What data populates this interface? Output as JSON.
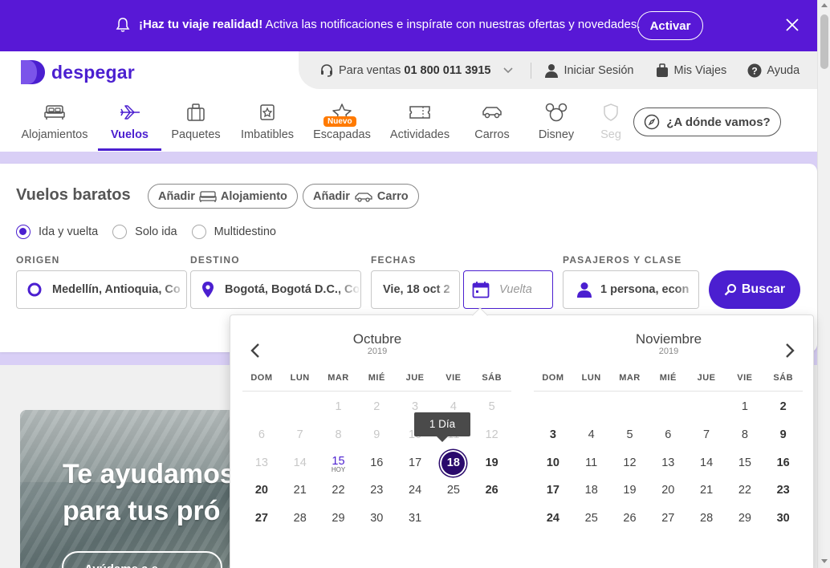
{
  "banner": {
    "bold_text": "¡Haz tu viaje realidad!",
    "text": " Activa las notificaciones e inspírate con nuestras ofertas y novedades.",
    "activate_label": "Activar",
    "bg_color": "#5818d6"
  },
  "brand": {
    "name": "despegar",
    "color": "#4b1fd0"
  },
  "topbar": {
    "sales_label": "Para ventas",
    "sales_phone": "01 800 011 3915",
    "login_label": "Iniciar Sesión",
    "trips_label": "Mis Viajes",
    "help_label": "Ayuda"
  },
  "nav": {
    "tabs": [
      {
        "label": "Alojamientos",
        "icon": "bed-icon"
      },
      {
        "label": "Vuelos",
        "icon": "plane-icon",
        "active": true
      },
      {
        "label": "Paquetes",
        "icon": "suitcase-icon"
      },
      {
        "label": "Imbatibles",
        "icon": "medal-icon"
      },
      {
        "label": "Escapadas",
        "icon": "star-icon",
        "badge": "Nuevo"
      },
      {
        "label": "Actividades",
        "icon": "ticket-icon"
      },
      {
        "label": "Carros",
        "icon": "car-icon"
      },
      {
        "label": "Disney",
        "icon": "mickey-icon"
      },
      {
        "label": "Seg",
        "icon": "shield-icon"
      }
    ],
    "where_label": "¿A dónde vamos?"
  },
  "search": {
    "title": "Vuelos baratos",
    "add_hotel_prefix": "Añadir",
    "add_hotel_label": "Alojamiento",
    "add_car_prefix": "Añadir",
    "add_car_label": "Carro",
    "trip_types": [
      "Ida y vuelta",
      "Solo ida",
      "Multidestino"
    ],
    "trip_type_selected": "Ida y vuelta",
    "origin_label": "ORIGEN",
    "origin_value": "Medellín, Antioquia, Co",
    "destination_label": "DESTINO",
    "destination_value": "Bogotá, Bogotá D.C., Co",
    "dates_label": "FECHAS",
    "depart_value": "Vie, 18 oct 2",
    "return_placeholder": "Vuelta",
    "passengers_label": "PASAJEROS Y CLASE",
    "passengers_value": "1 persona, econ",
    "search_label": "Buscar"
  },
  "promo": {
    "line1": "Te ayudamos",
    "line2": "para tus pró",
    "button": "Ayúdame a e"
  },
  "calendar": {
    "tooltip": "1 Día",
    "weekdays": [
      "DOM",
      "LUN",
      "MAR",
      "MIÉ",
      "JUE",
      "VIE",
      "SÁB"
    ],
    "today_label": "HOY",
    "months": [
      {
        "name": "Octubre",
        "year": "2019",
        "weeks": [
          [
            "",
            "",
            "1",
            "2",
            "3",
            "4",
            "5"
          ],
          [
            "6",
            "7",
            "8",
            "9",
            "10",
            "11",
            "12"
          ],
          [
            "13",
            "14",
            "15",
            "16",
            "17",
            "18",
            "19"
          ],
          [
            "20",
            "21",
            "22",
            "23",
            "24",
            "25",
            "26"
          ],
          [
            "27",
            "28",
            "29",
            "30",
            "31",
            "",
            ""
          ]
        ]
      },
      {
        "name": "Noviembre",
        "year": "2019",
        "weeks": [
          [
            "",
            "",
            "",
            "",
            "",
            "1",
            "2"
          ],
          [
            "3",
            "4",
            "5",
            "6",
            "7",
            "8",
            "9"
          ],
          [
            "10",
            "11",
            "12",
            "13",
            "14",
            "15",
            "16"
          ],
          [
            "17",
            "18",
            "19",
            "20",
            "21",
            "22",
            "23"
          ],
          [
            "24",
            "25",
            "26",
            "27",
            "28",
            "29",
            "30"
          ]
        ]
      }
    ],
    "selected": {
      "month": "Octubre",
      "day": "18"
    },
    "today": {
      "month": "Octubre",
      "day": "15"
    }
  }
}
